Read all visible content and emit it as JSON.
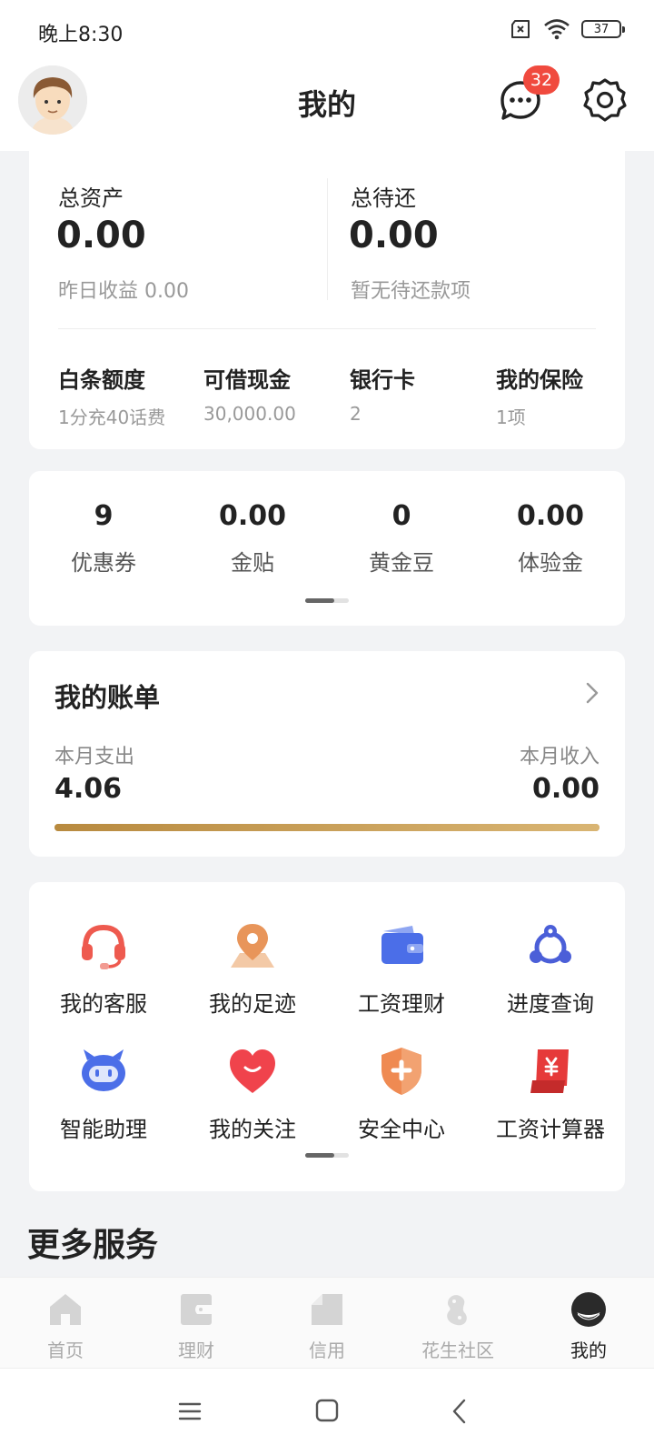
{
  "status": {
    "time": "晚上8:30",
    "battery": "37"
  },
  "header": {
    "title": "我的",
    "message_badge": "32"
  },
  "assets": {
    "total_assets_label": "总资产",
    "total_assets_value": "0.00",
    "yesterday_earnings": "昨日收益 0.00",
    "total_repay_label": "总待还",
    "total_repay_value": "0.00",
    "repay_note": "暂无待还款项",
    "items": [
      {
        "title": "白条额度",
        "sub": "1分充40话费"
      },
      {
        "title": "可借现金",
        "sub": "30,000.00"
      },
      {
        "title": "银行卡",
        "sub": "2"
      },
      {
        "title": "我的保险",
        "sub": "1项"
      }
    ]
  },
  "coupons": [
    {
      "value": "9",
      "label": "优惠券"
    },
    {
      "value": "0.00",
      "label": "金贴"
    },
    {
      "value": "0",
      "label": "黄金豆"
    },
    {
      "value": "0.00",
      "label": "体验金"
    }
  ],
  "bill": {
    "title": "我的账单",
    "expense_label": "本月支出",
    "expense_value": "4.06",
    "income_label": "本月收入",
    "income_value": "0.00",
    "progress": 1.0
  },
  "tools": [
    {
      "label": "我的客服",
      "icon": "headset-icon"
    },
    {
      "label": "我的足迹",
      "icon": "location-pin-icon"
    },
    {
      "label": "工资理财",
      "icon": "wallet-icon"
    },
    {
      "label": "进度查询",
      "icon": "progress-network-icon"
    },
    {
      "label": "智能助理",
      "icon": "robot-icon"
    },
    {
      "label": "我的关注",
      "icon": "heart-icon"
    },
    {
      "label": "安全中心",
      "icon": "shield-icon"
    },
    {
      "label": "工资计算器",
      "icon": "yuan-calculator-icon"
    }
  ],
  "more_services_title": "更多服务",
  "tabbar": [
    {
      "label": "首页",
      "icon": "home-icon"
    },
    {
      "label": "理财",
      "icon": "wallet-icon"
    },
    {
      "label": "信用",
      "icon": "document-icon"
    },
    {
      "label": "花生社区",
      "icon": "peanut-icon"
    },
    {
      "label": "我的",
      "icon": "profile-icon",
      "active": true
    }
  ],
  "colors": {
    "badge": "#f04a3e",
    "gold": "#c8a25a",
    "headset": "#ee5a4f",
    "pin": "#e8955a",
    "wallet": "#4b6ee8",
    "heart": "#f0434c"
  }
}
